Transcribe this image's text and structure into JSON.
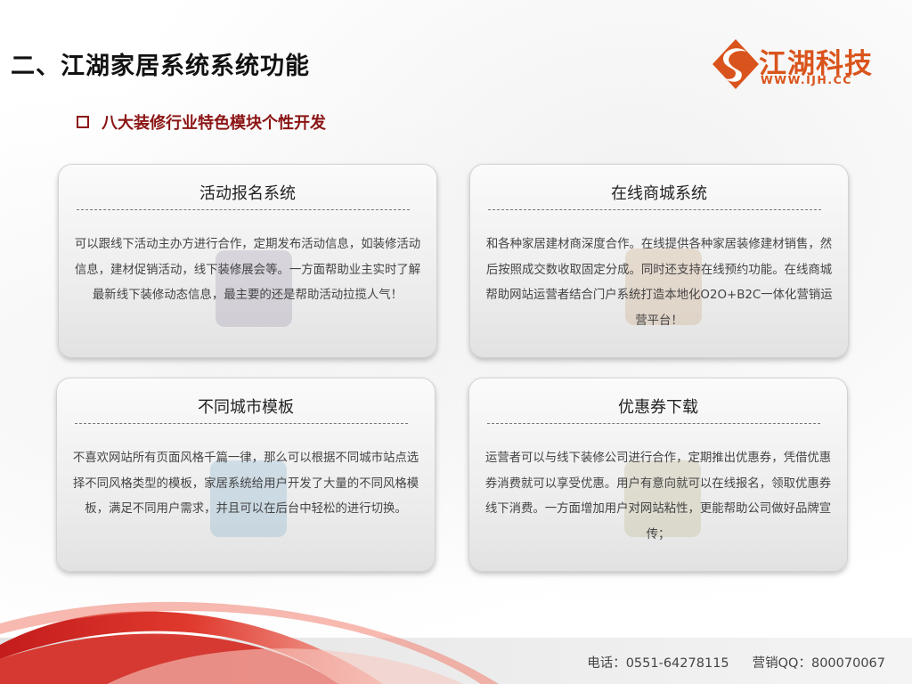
{
  "header": {
    "title": "二、江湖家居系统系统功能",
    "subtitle": "八大装修行业特色模块个性开发"
  },
  "logo": {
    "name": "江湖科技",
    "url": "WWW.IJH.CC",
    "color": "#d9541c"
  },
  "cards": [
    {
      "title": "活动报名系统",
      "body": "可以跟线下活动主办方进行合作，定期发布活动信息，如装修活动信息，建材促销活动，线下装修展会等。一方面帮助业主实时了解最新线下装修动态信息，最主要的还是帮助活动拉揽人气！"
    },
    {
      "title": "在线商城系统",
      "body": "和各种家居建材商深度合作。在线提供各种家居装修建材销售，然后按照成交数收取固定分成。同时还支持在线预约功能。在线商城帮助网站运营者结合门户系统打造本地化O2O+B2C一体化营销运营平台！"
    },
    {
      "title": "不同城市模板",
      "body": "不喜欢网站所有页面风格千篇一律，那么可以根据不同城市站点选择不同风格类型的模板，家居系统给用户开发了大量的不同风格模板，满足不同用户需求，并且可以在后台中轻松的进行切换。"
    },
    {
      "title": "优惠券下载",
      "body": "运营者可以与线下装修公司进行合作，定期推出优惠券，凭借优惠券消费就可以享受优惠。用户有意向就可以在线报名，领取优惠券线下消费。一方面增加用户对网站粘性，更能帮助公司做好品牌宣传；"
    }
  ],
  "footer": {
    "phone": "电话：0551-64278115",
    "qq": "营销QQ：800070067"
  },
  "colors": {
    "accent_red": "#d32222",
    "subtitle_red": "#8b1414"
  }
}
